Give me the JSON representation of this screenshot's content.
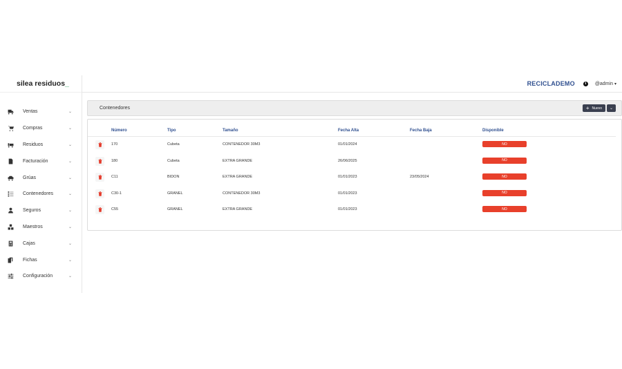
{
  "app": {
    "logo_text": "silea residuos",
    "logo_cursor": "_",
    "company": "RECICLADEMO",
    "user": "@admin"
  },
  "sidebar": {
    "items": [
      {
        "label": "Ventas",
        "icon": "truck-icon"
      },
      {
        "label": "Compras",
        "icon": "cart-icon"
      },
      {
        "label": "Residuos",
        "icon": "waste-truck-icon"
      },
      {
        "label": "Facturación",
        "icon": "invoice-icon"
      },
      {
        "label": "Grúas",
        "icon": "car-icon"
      },
      {
        "label": "Contenedores",
        "icon": "list-icon"
      },
      {
        "label": "Seguros",
        "icon": "user-shield-icon"
      },
      {
        "label": "Maestros",
        "icon": "boxes-icon"
      },
      {
        "label": "Cajas",
        "icon": "calculator-icon"
      },
      {
        "label": "Fichas",
        "icon": "files-icon"
      },
      {
        "label": "Configuración",
        "icon": "sliders-icon"
      }
    ]
  },
  "panel": {
    "title": "Contenedores",
    "new_button": "Nuevo"
  },
  "table": {
    "headers": [
      "Número",
      "Tipo",
      "Tamaño",
      "Fecha Alta",
      "Fecha Baja",
      "Disponible"
    ],
    "rows": [
      {
        "numero": "170",
        "tipo": "Cubeta",
        "tamano": "CONTENEDOR 30M3",
        "fecha_alta": "01/01/2024",
        "fecha_baja": "",
        "disponible": "NO"
      },
      {
        "numero": "180",
        "tipo": "Cubeta",
        "tamano": "EXTRA GRANDE",
        "fecha_alta": "26/06/2025",
        "fecha_baja": "",
        "disponible": "NO"
      },
      {
        "numero": "C11",
        "tipo": "BIDON",
        "tamano": "EXTRA GRANDE",
        "fecha_alta": "01/01/2023",
        "fecha_baja": "23/05/2024",
        "disponible": "NO"
      },
      {
        "numero": "C30-1",
        "tipo": "GRANEL",
        "tamano": "CONTENEDOR 30M3",
        "fecha_alta": "01/01/2023",
        "fecha_baja": "",
        "disponible": "NO"
      },
      {
        "numero": "C55",
        "tipo": "GRANEL",
        "tamano": "EXTRA GRANDE",
        "fecha_alta": "01/01/2023",
        "fecha_baja": "",
        "disponible": "NO"
      }
    ]
  },
  "colors": {
    "brand": "#2f4f8f",
    "danger": "#e8402b",
    "button_dark": "#3a3f4f"
  }
}
